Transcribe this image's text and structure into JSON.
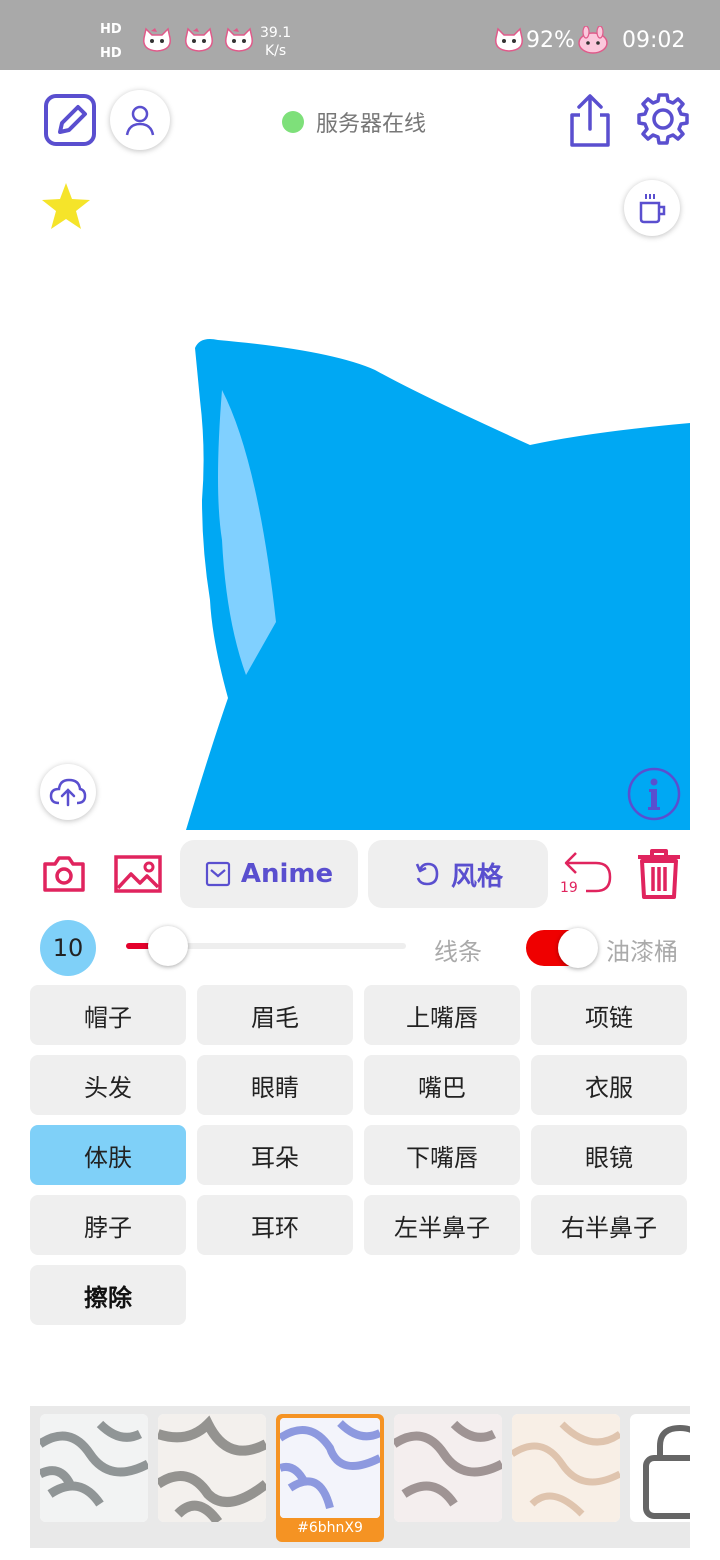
{
  "status_bar": {
    "hd_top": "HD",
    "hd_bottom": "HD",
    "speed_value": "39.1",
    "speed_unit": "K/s",
    "battery": "92%",
    "time": "09:02"
  },
  "header": {
    "server_status": "服务器在线",
    "server_status_color": "#7ee07a",
    "accent": "#5a4fcf",
    "icons": [
      "edit-icon",
      "user-icon",
      "share-icon",
      "settings-icon",
      "star-icon",
      "coffee-icon"
    ]
  },
  "canvas": {
    "fill_color": "#00a8f3",
    "highlight_color": "#80d0ff",
    "icons": [
      "cloud-upload-icon",
      "info-icon"
    ]
  },
  "tools": {
    "anime_label": "Anime",
    "style_label": "风格",
    "undo_count": "19",
    "icons": [
      "camera-icon",
      "image-icon",
      "undo-icon",
      "trash-icon"
    ]
  },
  "brush": {
    "size": "10",
    "slider_fraction": 0.15,
    "line_label": "线条",
    "bucket_label": "油漆桶",
    "bucket_on": true
  },
  "parts": [
    {
      "label": "帽子"
    },
    {
      "label": "眉毛"
    },
    {
      "label": "上嘴唇"
    },
    {
      "label": "项链"
    },
    {
      "label": "头发"
    },
    {
      "label": "眼睛"
    },
    {
      "label": "嘴巴"
    },
    {
      "label": "衣服"
    },
    {
      "label": "体肤",
      "active": true
    },
    {
      "label": "耳朵"
    },
    {
      "label": "下嘴唇"
    },
    {
      "label": "眼镜"
    },
    {
      "label": "脖子"
    },
    {
      "label": "耳环"
    },
    {
      "label": "左半鼻子"
    },
    {
      "label": "右半鼻子"
    },
    {
      "label": "擦除",
      "bold": true
    }
  ],
  "styles": {
    "selected_code": "#6bhnX9",
    "selected_color": "#f59323",
    "count_visible": 6
  }
}
